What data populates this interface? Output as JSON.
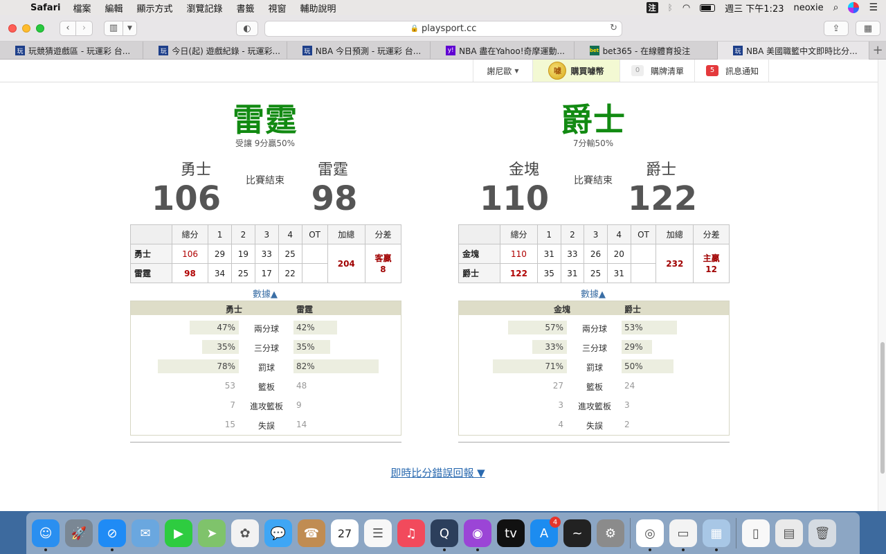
{
  "menubar": {
    "app": "Safari",
    "items": [
      "檔案",
      "編輯",
      "顯示方式",
      "瀏覽記錄",
      "書籤",
      "視窗",
      "輔助說明"
    ],
    "ime": "注",
    "clock": "週三 下午1:23",
    "user": "neoxie"
  },
  "toolbar": {
    "url": "playsport.cc"
  },
  "tabs": [
    {
      "title": "玩競猜遊戲區 - 玩運彩 台...",
      "icon": "playsport-favicon"
    },
    {
      "title": "今日(起) 遊戲紀錄 - 玩運彩...",
      "icon": "playsport-favicon"
    },
    {
      "title": "NBA 今日預測 - 玩運彩 台...",
      "icon": "playsport-favicon"
    },
    {
      "title": "NBA 盡在Yahoo!奇摩運動...",
      "icon": "yahoo-favicon"
    },
    {
      "title": "bet365 - 在線體育投注",
      "icon": "bet365-favicon"
    },
    {
      "title": "NBA 美國職籃中文即時比分...",
      "icon": "playsport-favicon"
    }
  ],
  "sitebar": {
    "user": "謝尼歐",
    "buy": "購買噱幣",
    "coin_glyph": "噱",
    "cart_count": "0",
    "cart": "購牌清單",
    "msg_count": "5",
    "msg": "訊息通知"
  },
  "games": [
    {
      "winner": "雷霆",
      "winner_sub": "受讓 9分贏50%",
      "away": "勇士",
      "home": "雷霆",
      "status": "比賽結束",
      "away_score": "106",
      "home_score": "98",
      "headers": [
        "總分",
        "1",
        "2",
        "3",
        "4",
        "OT",
        "加總",
        "分差"
      ],
      "rows": [
        {
          "team": "勇士",
          "total": "106",
          "q": [
            "29",
            "19",
            "33",
            "25"
          ],
          "ot": ""
        },
        {
          "team": "雷霆",
          "total": "98",
          "q": [
            "34",
            "25",
            "17",
            "22"
          ],
          "ot": ""
        }
      ],
      "sum": "204",
      "diff": "客贏\n8",
      "data_link": "數據▲",
      "stat_head_left": "勇士",
      "stat_head_right": "雷霆",
      "stats": [
        {
          "label": "兩分球",
          "left": "47%",
          "right": "42%",
          "lf": 0.47,
          "rf": 0.42,
          "bar": true
        },
        {
          "label": "三分球",
          "left": "35%",
          "right": "35%",
          "lf": 0.35,
          "rf": 0.35,
          "bar": true
        },
        {
          "label": "罰球",
          "left": "78%",
          "right": "82%",
          "lf": 0.78,
          "rf": 0.82,
          "bar": true
        },
        {
          "label": "籃板",
          "left": "53",
          "right": "48",
          "bar": false
        },
        {
          "label": "進攻籃板",
          "left": "7",
          "right": "9",
          "bar": false
        },
        {
          "label": "失誤",
          "left": "15",
          "right": "14",
          "bar": false
        }
      ]
    },
    {
      "winner": "爵士",
      "winner_sub": "7分輸50%",
      "away": "金塊",
      "home": "爵士",
      "status": "比賽結束",
      "away_score": "110",
      "home_score": "122",
      "headers": [
        "總分",
        "1",
        "2",
        "3",
        "4",
        "OT",
        "加總",
        "分差"
      ],
      "rows": [
        {
          "team": "金塊",
          "total": "110",
          "q": [
            "31",
            "33",
            "26",
            "20"
          ],
          "ot": ""
        },
        {
          "team": "爵士",
          "total": "122",
          "q": [
            "35",
            "31",
            "25",
            "31"
          ],
          "ot": ""
        }
      ],
      "sum": "232",
      "diff": "主贏\n12",
      "data_link": "數據▲",
      "stat_head_left": "金塊",
      "stat_head_right": "爵士",
      "stats": [
        {
          "label": "兩分球",
          "left": "57%",
          "right": "53%",
          "lf": 0.57,
          "rf": 0.53,
          "bar": true
        },
        {
          "label": "三分球",
          "left": "33%",
          "right": "29%",
          "lf": 0.33,
          "rf": 0.29,
          "bar": true
        },
        {
          "label": "罰球",
          "left": "71%",
          "right": "50%",
          "lf": 0.71,
          "rf": 0.5,
          "bar": true
        },
        {
          "label": "籃板",
          "left": "27",
          "right": "24",
          "bar": false
        },
        {
          "label": "進攻籃板",
          "left": "3",
          "right": "3",
          "bar": false
        },
        {
          "label": "失誤",
          "left": "4",
          "right": "2",
          "bar": false
        }
      ]
    }
  ],
  "report_link": "即時比分錯誤回報 ▼",
  "dock": [
    {
      "name": "finder-icon",
      "color": "#2a8ff0",
      "glyph": "☺",
      "running": true
    },
    {
      "name": "launchpad-icon",
      "color": "#7a8794",
      "glyph": "🚀",
      "running": false
    },
    {
      "name": "safari-icon",
      "color": "#1f8bf5",
      "glyph": "⊘",
      "running": true
    },
    {
      "name": "mail-icon",
      "color": "#6aa7df",
      "glyph": "✉",
      "running": false
    },
    {
      "name": "facetime-icon",
      "color": "#2ecc40",
      "glyph": "▶",
      "running": false
    },
    {
      "name": "maps-icon",
      "color": "#7fc36b",
      "glyph": "➤",
      "running": false
    },
    {
      "name": "photos-icon",
      "color": "#f2f2f2",
      "glyph": "✿",
      "running": false
    },
    {
      "name": "messages-icon",
      "color": "#3ea6f5",
      "glyph": "💬",
      "running": false
    },
    {
      "name": "contacts-icon",
      "color": "#c08c52",
      "glyph": "☎",
      "running": false
    },
    {
      "name": "calendar-icon",
      "color": "#ffffff",
      "glyph": "27",
      "running": false
    },
    {
      "name": "reminders-icon",
      "color": "#f7f7f7",
      "glyph": "☰",
      "running": false
    },
    {
      "name": "music-icon",
      "color": "#f24a5c",
      "glyph": "♫",
      "running": false
    },
    {
      "name": "quicktime-icon",
      "color": "#2c3f5c",
      "glyph": "Q",
      "running": true
    },
    {
      "name": "podcasts-icon",
      "color": "#9b45d6",
      "glyph": "◉",
      "running": true
    },
    {
      "name": "tv-icon",
      "color": "#111111",
      "glyph": "tv",
      "running": false
    },
    {
      "name": "appstore-icon",
      "color": "#1c8cf0",
      "glyph": "A",
      "running": false,
      "badge": "4"
    },
    {
      "name": "voice-memos-icon",
      "color": "#222222",
      "glyph": "~",
      "running": false
    },
    {
      "name": "system-preferences-icon",
      "color": "#8b8b8b",
      "glyph": "⚙",
      "running": false
    },
    {
      "name": "chrome-icon",
      "color": "#ffffff",
      "glyph": "◎",
      "running": true,
      "sepBefore": true
    },
    {
      "name": "document-icon",
      "color": "#f3f3f3",
      "glyph": "▭",
      "running": true
    },
    {
      "name": "preview-icon",
      "color": "#a8c7e6",
      "glyph": "▦",
      "running": true
    },
    {
      "name": "file-icon",
      "color": "#f8f8f8",
      "glyph": "▯",
      "running": false,
      "sepBefore": true
    },
    {
      "name": "spreadsheet-icon",
      "color": "#eaeaea",
      "glyph": "▤",
      "running": false
    },
    {
      "name": "trash-icon",
      "color": "#d5dbe2",
      "glyph": "🗑",
      "running": false
    }
  ]
}
